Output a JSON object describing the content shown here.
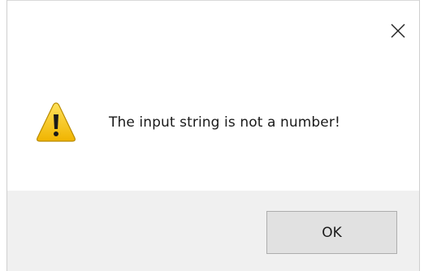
{
  "dialog": {
    "message": "The input string is not a number!",
    "ok_label": "OK",
    "icon": "warning-icon",
    "close_icon": "close-icon"
  },
  "colors": {
    "footer_bg": "#f0f0f0",
    "button_bg": "#e1e1e1",
    "button_border": "#adadad",
    "warning_yellow": "#f4c20d"
  }
}
